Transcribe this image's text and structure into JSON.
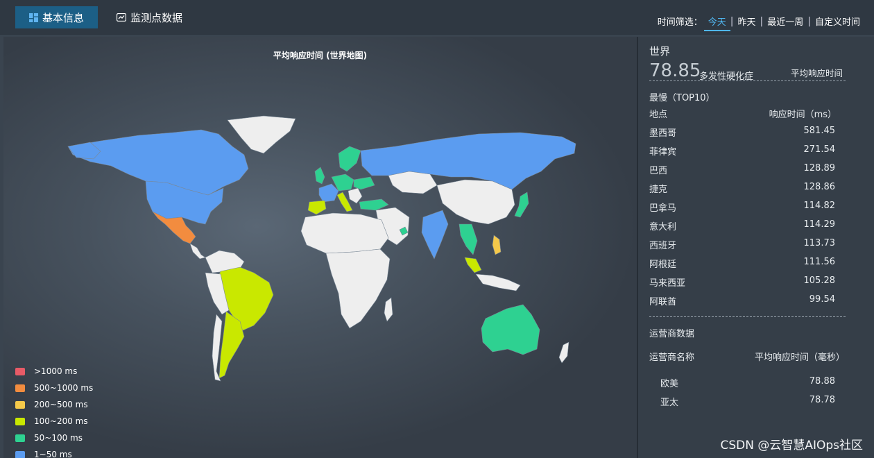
{
  "header": {
    "tab_basic": "基本信息",
    "tab_monitor": "监测点数据",
    "filter_label": "时间筛选：",
    "filter_options": [
      "今天",
      "昨天",
      "最近一周",
      "自定义时间"
    ],
    "filter_selected": "今天"
  },
  "map": {
    "title": "平均响应时间 (世界地图)",
    "legend": [
      {
        "label": ">1000 ms",
        "color": "#e85b67"
      },
      {
        "label": "500~1000 ms",
        "color": "#f28c3f"
      },
      {
        "label": "200~500 ms",
        "color": "#f5c94a"
      },
      {
        "label": "100~200 ms",
        "color": "#c9e800"
      },
      {
        "label": "50~100 ms",
        "color": "#2ed191"
      },
      {
        "label": "1~50 ms",
        "color": "#5b9cf0"
      }
    ],
    "no_data_color": "#eeeeee"
  },
  "panel": {
    "region": "世界",
    "avg_value": "78.85",
    "avg_suffix": "多发性硬化症",
    "avg_label": "平均响应时间",
    "slow_title": "最慢（TOP10）",
    "col_place": "地点",
    "col_time": "响应时间（ms）",
    "rows": [
      {
        "place": "墨西哥",
        "time": "581.45"
      },
      {
        "place": "菲律宾",
        "time": "271.54"
      },
      {
        "place": "巴西",
        "time": "128.89"
      },
      {
        "place": "捷克",
        "time": "128.86"
      },
      {
        "place": "巴拿马",
        "time": "114.82"
      },
      {
        "place": "意大利",
        "time": "114.29"
      },
      {
        "place": "西班牙",
        "time": "113.73"
      },
      {
        "place": "阿根廷",
        "time": "111.56"
      },
      {
        "place": "马来西亚",
        "time": "105.28"
      },
      {
        "place": "阿联酋",
        "time": "99.54"
      }
    ],
    "operator_title": "运营商数据",
    "op_col_name": "运营商名称",
    "op_col_time": "平均响应时间（毫秒）",
    "operators": [
      {
        "name": "欧美",
        "time": "78.88"
      },
      {
        "name": "亚太",
        "time": "78.78"
      }
    ]
  },
  "watermark": "CSDN @云智慧AIOps社区"
}
